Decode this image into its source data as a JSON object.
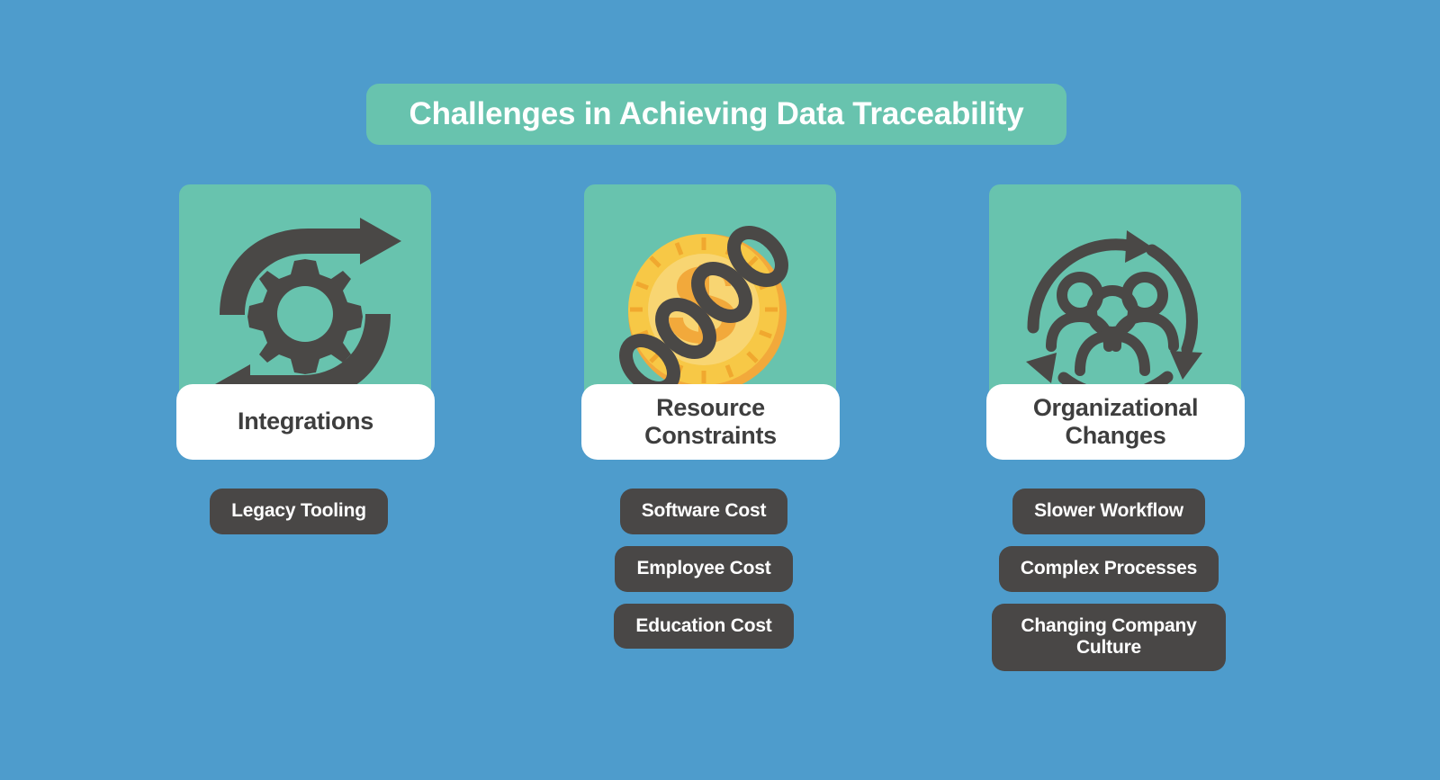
{
  "title": {
    "text": "Challenges in Achieving Data Traceability"
  },
  "colors": {
    "background": "#4e9ccc",
    "card_green": "#68c3ae",
    "label_white": "#ffffff",
    "pill_dark": "#494746",
    "text_dark": "#3e3e3e",
    "coin_gold": "#f5b731",
    "coin_gold_light": "#f8d572",
    "coin_gold_mid": "#f7c846",
    "icon_dark": "#4a4846"
  },
  "columns": [
    {
      "icon": "gear-sync-icon",
      "label": "Integrations",
      "pills": [
        "Legacy Tooling"
      ]
    },
    {
      "icon": "coin-chain-icon",
      "label": "Resource Constraints",
      "pills": [
        "Software Cost",
        "Employee Cost",
        "Education Cost"
      ]
    },
    {
      "icon": "people-cycle-icon",
      "label": "Organizational Changes",
      "pills": [
        "Slower Workflow",
        "Complex Processes",
        "Changing Company Culture"
      ]
    }
  ]
}
